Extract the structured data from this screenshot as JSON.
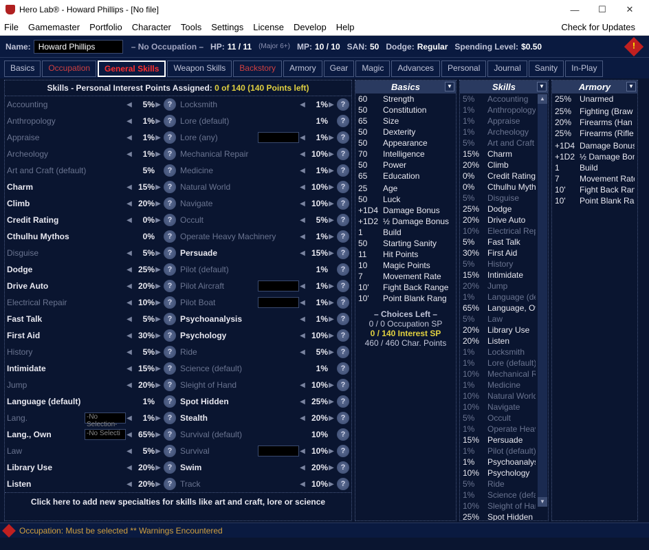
{
  "window": {
    "title": "Hero Lab® -  Howard Phillips  -  [No file]"
  },
  "menu": [
    "File",
    "Gamemaster",
    "Portfolio",
    "Character",
    "Tools",
    "Settings",
    "License",
    "Develop",
    "Help"
  ],
  "menu_right": "Check for Updates",
  "header": {
    "name_lbl": "Name:",
    "name_val": "Howard Phillips",
    "occ": "– No Occupation –",
    "hp_lbl": "HP:",
    "hp_val": "11 / 11",
    "hp_sub": "(Major 6+)",
    "mp_lbl": "MP:",
    "mp_val": "10 / 10",
    "san_lbl": "SAN:",
    "san_val": "50",
    "dodge_lbl": "Dodge:",
    "dodge_val": "Regular",
    "spend_lbl": "Spending Level:",
    "spend_val": "$0.50"
  },
  "tabs": [
    "Basics",
    "Occupation",
    "General Skills",
    "Weapon Skills",
    "Backstory",
    "Armory",
    "Gear",
    "Magic",
    "Advances",
    "Personal",
    "Journal",
    "Sanity",
    "In-Play"
  ],
  "skill_header": {
    "t1": "Skills - Personal Interest Points Assigned: ",
    "t2": "0 of 140 (140 Points left)"
  },
  "skills_left": [
    {
      "n": "Accounting",
      "p": "5%",
      "d": 1,
      "a": 1
    },
    {
      "n": "Anthropology",
      "p": "1%",
      "d": 1,
      "a": 1
    },
    {
      "n": "Appraise",
      "p": "1%",
      "d": 1,
      "a": 1
    },
    {
      "n": "Archeology",
      "p": "1%",
      "d": 1,
      "a": 1
    },
    {
      "n": "Art and Craft (default)",
      "p": "5%",
      "d": 1,
      "a": 0
    },
    {
      "n": "Charm",
      "p": "15%",
      "d": 0,
      "a": 1,
      "b": 1
    },
    {
      "n": "Climb",
      "p": "20%",
      "d": 0,
      "a": 1,
      "b": 1
    },
    {
      "n": "Credit Rating",
      "p": "0%",
      "d": 0,
      "a": 1,
      "b": 1
    },
    {
      "n": "Cthulhu Mythos",
      "p": "0%",
      "d": 0,
      "a": 0,
      "b": 1
    },
    {
      "n": "Disguise",
      "p": "5%",
      "d": 1,
      "a": 1
    },
    {
      "n": "Dodge",
      "p": "25%",
      "d": 0,
      "a": 1,
      "b": 1
    },
    {
      "n": "Drive Auto",
      "p": "20%",
      "d": 0,
      "a": 1,
      "b": 1
    },
    {
      "n": "Electrical Repair",
      "p": "10%",
      "d": 1,
      "a": 1
    },
    {
      "n": "Fast Talk",
      "p": "5%",
      "d": 0,
      "a": 1,
      "b": 1
    },
    {
      "n": "First Aid",
      "p": "30%",
      "d": 0,
      "a": 1,
      "b": 1
    },
    {
      "n": "History",
      "p": "5%",
      "d": 1,
      "a": 1
    },
    {
      "n": "Intimidate",
      "p": "15%",
      "d": 0,
      "a": 1,
      "b": 1
    },
    {
      "n": "Jump",
      "p": "20%",
      "d": 1,
      "a": 1
    },
    {
      "n": "Language (default)",
      "p": "1%",
      "d": 0,
      "a": 0,
      "b": 1
    },
    {
      "n": "Lang.",
      "p": "1%",
      "d": 1,
      "a": 1,
      "sel": "-No Selection-"
    },
    {
      "n": "Lang., Own",
      "p": "65%",
      "d": 0,
      "a": 1,
      "sel": "-No Selecti",
      "b": 1
    },
    {
      "n": "Law",
      "p": "5%",
      "d": 1,
      "a": 1
    },
    {
      "n": "Library Use",
      "p": "20%",
      "d": 0,
      "a": 1,
      "b": 1
    },
    {
      "n": "Listen",
      "p": "20%",
      "d": 0,
      "a": 1,
      "b": 1
    }
  ],
  "skills_right": [
    {
      "n": "Locksmith",
      "p": "1%",
      "d": 1,
      "a": 1
    },
    {
      "n": "Lore (default)",
      "p": "1%",
      "d": 1,
      "a": 0
    },
    {
      "n": "Lore (any)",
      "p": "1%",
      "d": 1,
      "a": 1,
      "inp": 1
    },
    {
      "n": "Mechanical Repair",
      "p": "10%",
      "d": 1,
      "a": 1
    },
    {
      "n": "Medicine",
      "p": "1%",
      "d": 1,
      "a": 1
    },
    {
      "n": "Natural World",
      "p": "10%",
      "d": 1,
      "a": 1
    },
    {
      "n": "Navigate",
      "p": "10%",
      "d": 1,
      "a": 1
    },
    {
      "n": "Occult",
      "p": "5%",
      "d": 1,
      "a": 1
    },
    {
      "n": "Operate Heavy Machinery",
      "p": "1%",
      "d": 1,
      "a": 1
    },
    {
      "n": "Persuade",
      "p": "15%",
      "d": 0,
      "a": 1,
      "b": 1
    },
    {
      "n": "Pilot (default)",
      "p": "1%",
      "d": 1,
      "a": 0
    },
    {
      "n": "Pilot Aircraft",
      "p": "1%",
      "d": 1,
      "a": 1,
      "inp": 1
    },
    {
      "n": "Pilot Boat",
      "p": "1%",
      "d": 1,
      "a": 1,
      "inp": 1
    },
    {
      "n": "Psychoanalysis",
      "p": "1%",
      "d": 0,
      "a": 1,
      "b": 1
    },
    {
      "n": "Psychology",
      "p": "10%",
      "d": 0,
      "a": 1,
      "b": 1
    },
    {
      "n": "Ride",
      "p": "5%",
      "d": 1,
      "a": 1
    },
    {
      "n": "Science (default)",
      "p": "1%",
      "d": 1,
      "a": 0
    },
    {
      "n": "Sleight of Hand",
      "p": "10%",
      "d": 1,
      "a": 1
    },
    {
      "n": "Spot Hidden",
      "p": "25%",
      "d": 0,
      "a": 1,
      "b": 1
    },
    {
      "n": "Stealth",
      "p": "20%",
      "d": 0,
      "a": 1,
      "b": 1
    },
    {
      "n": "Survival (default)",
      "p": "10%",
      "d": 1,
      "a": 0
    },
    {
      "n": "Survival",
      "p": "10%",
      "d": 1,
      "a": 1,
      "inp": 1
    },
    {
      "n": "Swim",
      "p": "20%",
      "d": 0,
      "a": 1,
      "b": 1
    },
    {
      "n": "Track",
      "p": "10%",
      "d": 1,
      "a": 1
    }
  ],
  "add_specialty": "Click here to add new specialties for skills like art and craft, lore or science",
  "basics_head": "Basics",
  "basics": [
    {
      "v": "60",
      "n": "Strength"
    },
    {
      "v": "50",
      "n": "Constitution"
    },
    {
      "v": "65",
      "n": "Size"
    },
    {
      "v": "50",
      "n": "Dexterity"
    },
    {
      "v": "50",
      "n": "Appearance"
    },
    {
      "v": "70",
      "n": "Intelligence"
    },
    {
      "v": "50",
      "n": "Power"
    },
    {
      "v": "65",
      "n": "Education"
    },
    {
      "v": "",
      "n": ""
    },
    {
      "v": "25",
      "n": "Age"
    },
    {
      "v": "50",
      "n": "Luck"
    },
    {
      "v": "+1D4",
      "n": "Damage Bonus"
    },
    {
      "v": "+1D2",
      "n": "½ Damage Bonus"
    },
    {
      "v": "1",
      "n": "Build"
    },
    {
      "v": "50",
      "n": "Starting Sanity"
    },
    {
      "v": "11",
      "n": "Hit Points"
    },
    {
      "v": "10",
      "n": "Magic Points"
    },
    {
      "v": "7",
      "n": "Movement Rate"
    },
    {
      "v": "10'",
      "n": "Fight Back Range"
    },
    {
      "v": "10'",
      "n": "Point Blank Rang"
    }
  ],
  "choices": {
    "h": "– Choices Left –",
    "l1": "0 / 0  Occupation SP",
    "l2": "0 / 140  Interest SP",
    "l3": "460 / 460  Char. Points"
  },
  "skills_head": "Skills",
  "skills_panel": [
    {
      "v": "5%",
      "n": "Accounting",
      "d": 1
    },
    {
      "v": "1%",
      "n": "Anthropology",
      "d": 1
    },
    {
      "v": "1%",
      "n": "Appraise",
      "d": 1
    },
    {
      "v": "1%",
      "n": "Archeology",
      "d": 1
    },
    {
      "v": "5%",
      "n": "Art and Craft (d",
      "d": 1
    },
    {
      "v": "15%",
      "n": "Charm"
    },
    {
      "v": "20%",
      "n": "Climb"
    },
    {
      "v": "0%",
      "n": "Credit Rating"
    },
    {
      "v": "0%",
      "n": "Cthulhu Mytho"
    },
    {
      "v": "5%",
      "n": "Disguise",
      "d": 1
    },
    {
      "v": "25%",
      "n": "Dodge"
    },
    {
      "v": "20%",
      "n": "Drive Auto"
    },
    {
      "v": "10%",
      "n": "Electrical Repa",
      "d": 1
    },
    {
      "v": "5%",
      "n": "Fast Talk"
    },
    {
      "v": "30%",
      "n": "First Aid"
    },
    {
      "v": "5%",
      "n": "History",
      "d": 1
    },
    {
      "v": "15%",
      "n": "Intimidate"
    },
    {
      "v": "20%",
      "n": "Jump",
      "d": 1
    },
    {
      "v": "1%",
      "n": "Language (def",
      "d": 1
    },
    {
      "v": "65%",
      "n": "Language, Ow"
    },
    {
      "v": "5%",
      "n": "Law",
      "d": 1
    },
    {
      "v": "20%",
      "n": "Library Use"
    },
    {
      "v": "20%",
      "n": "Listen"
    },
    {
      "v": "1%",
      "n": "Locksmith",
      "d": 1
    },
    {
      "v": "1%",
      "n": "Lore (default)",
      "d": 1
    },
    {
      "v": "10%",
      "n": "Mechanical Re",
      "d": 1
    },
    {
      "v": "1%",
      "n": "Medicine",
      "d": 1
    },
    {
      "v": "10%",
      "n": "Natural World",
      "d": 1
    },
    {
      "v": "10%",
      "n": "Navigate",
      "d": 1
    },
    {
      "v": "5%",
      "n": "Occult",
      "d": 1
    },
    {
      "v": "1%",
      "n": "Operate Heavy",
      "d": 1
    },
    {
      "v": "15%",
      "n": "Persuade"
    },
    {
      "v": "1%",
      "n": "Pilot (default)",
      "d": 1
    },
    {
      "v": "1%",
      "n": "Psychoanalysi"
    },
    {
      "v": "10%",
      "n": "Psychology"
    },
    {
      "v": "5%",
      "n": "Ride",
      "d": 1
    },
    {
      "v": "1%",
      "n": "Science (defau",
      "d": 1
    },
    {
      "v": "10%",
      "n": "Sleight of Hand",
      "d": 1
    },
    {
      "v": "25%",
      "n": "Spot Hidden"
    }
  ],
  "armory_head": "Armory",
  "armory": [
    {
      "v": "25%",
      "n": "Unarmed"
    },
    {
      "v": "",
      "n": ""
    },
    {
      "v": "25%",
      "n": "Fighting (Braw"
    },
    {
      "v": "20%",
      "n": "Firearms (Han"
    },
    {
      "v": "25%",
      "n": "Firearms (Rifle"
    },
    {
      "v": "",
      "n": ""
    },
    {
      "v": "+1D4",
      "n": "Damage Bonus"
    },
    {
      "v": "+1D2",
      "n": "½ Damage Bonus"
    },
    {
      "v": "1",
      "n": "Build"
    },
    {
      "v": "7",
      "n": "Movement Rate"
    },
    {
      "v": "10'",
      "n": "Fight Back Range"
    },
    {
      "v": "10'",
      "n": "Point Blank Rang"
    }
  ],
  "footer": "Occupation: Must be selected ** Warnings Encountered"
}
